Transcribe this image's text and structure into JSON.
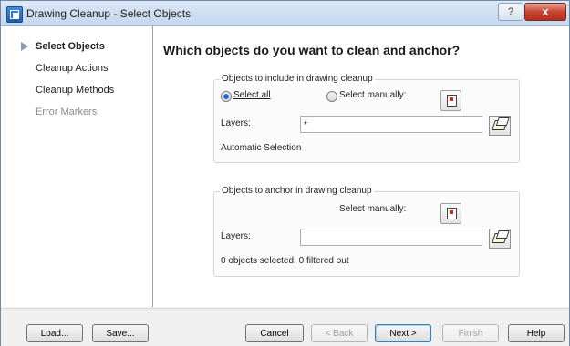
{
  "window": {
    "title": "Drawing Cleanup - Select Objects",
    "help_label": "?",
    "close_label": "x"
  },
  "sidebar": {
    "items": [
      {
        "label": "Select Objects",
        "state": "active"
      },
      {
        "label": "Cleanup Actions",
        "state": "normal"
      },
      {
        "label": "Cleanup Methods",
        "state": "normal"
      },
      {
        "label": "Error Markers",
        "state": "disabled"
      }
    ]
  },
  "main": {
    "heading": "Which objects do you want to clean and anchor?",
    "include_group": {
      "title": "Objects to include in drawing cleanup",
      "select_all_label": "Select all",
      "select_manually_label": "Select manually:",
      "selected": "select-all",
      "layers_label": "Layers:",
      "layers_value": "*",
      "status": "Automatic Selection"
    },
    "anchor_group": {
      "title": "Objects to anchor in drawing cleanup",
      "select_manually_label": "Select manually:",
      "layers_label": "Layers:",
      "layers_value": "",
      "status": "0 objects selected, 0 filtered out"
    }
  },
  "footer": {
    "load_label": "Load...",
    "save_label": "Save...",
    "cancel_label": "Cancel",
    "back_label": "< Back",
    "next_label": "Next >",
    "finish_label": "Finish",
    "help_label": "Help"
  }
}
